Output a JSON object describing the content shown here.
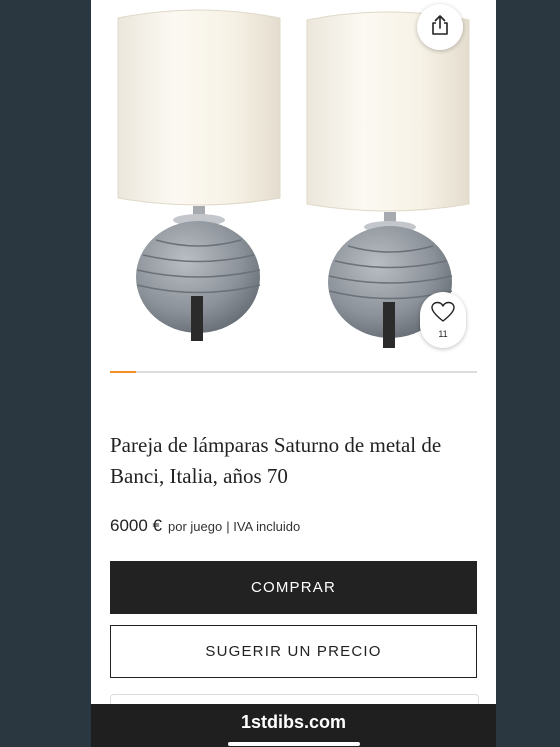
{
  "product": {
    "title": "Pareja de lámparas Saturno de metal de Banci, Italia, años 70",
    "price": "6000 €",
    "price_unit": "por juego",
    "price_tax": "| IVA incluido",
    "favorites_count": "11"
  },
  "gallery": {
    "progress_fraction": 0.07,
    "icons": {
      "share": "share-icon",
      "favorite": "heart-icon"
    }
  },
  "actions": {
    "buy_label": "COMPRAR",
    "offer_label": "SUGERIR UN PRECIO"
  },
  "browser": {
    "domain": "1stdibs.com"
  },
  "colors": {
    "accent": "#f3902b",
    "button_dark": "#222222",
    "background": "#2a3640"
  }
}
